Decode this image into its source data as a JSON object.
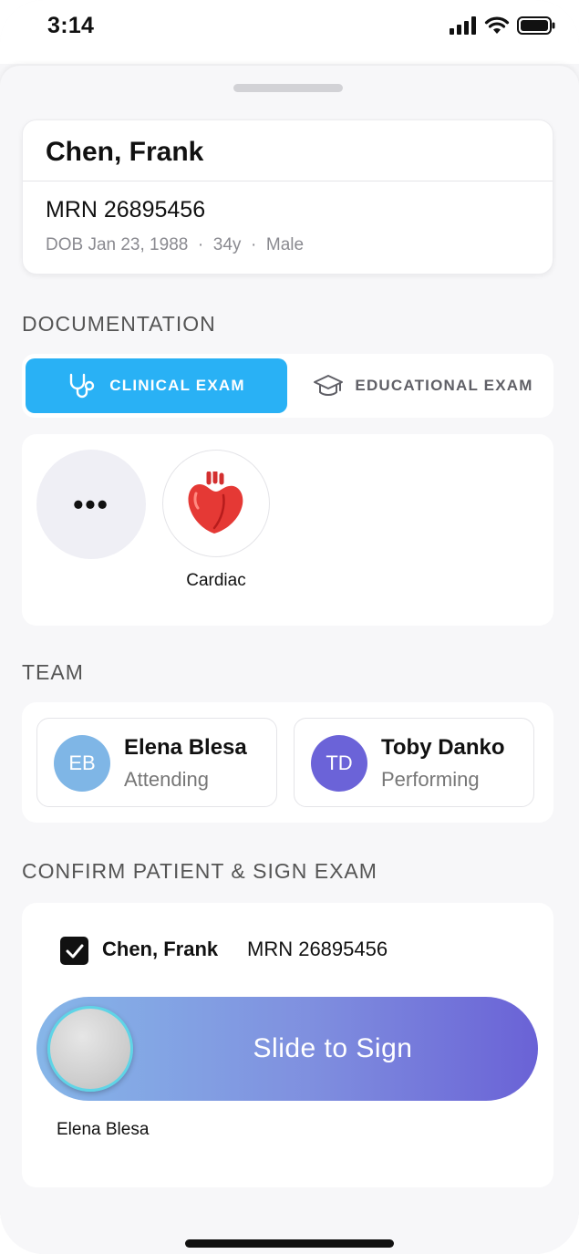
{
  "status_bar": {
    "time": "3:14"
  },
  "patient": {
    "name": "Chen, Frank",
    "mrn": "MRN 26895456",
    "dob": "DOB Jan 23, 1988",
    "age": "34y",
    "sex": "Male",
    "separator": "·"
  },
  "documentation": {
    "title": "DOCUMENTATION",
    "tabs": [
      {
        "label": "CLINICAL EXAM",
        "icon": "stethoscope-icon",
        "selected": true
      },
      {
        "label": "EDUCATIONAL EXAM",
        "icon": "graduation-cap-icon",
        "selected": false
      }
    ],
    "more_label": "•••",
    "exam_types": [
      {
        "label": "Cardiac",
        "icon": "heart-icon"
      }
    ]
  },
  "team": {
    "title": "TEAM",
    "members": [
      {
        "initials": "EB",
        "name": "Elena Blesa",
        "role": "Attending",
        "color": "#7fb6e6"
      },
      {
        "initials": "TD",
        "name": "Toby Danko",
        "role": "Performing",
        "color": "#6b63d8"
      }
    ]
  },
  "confirm": {
    "title": "CONFIRM PATIENT & SIGN EXAM",
    "checked": true,
    "patient_name": "Chen, Frank",
    "patient_mrn": "MRN 26895456",
    "slider_label": "Slide to Sign",
    "signer": "Elena Blesa"
  },
  "colors": {
    "accent": "#29b1f5",
    "slider_start": "#86b6e8",
    "slider_end": "#6a62d6"
  }
}
